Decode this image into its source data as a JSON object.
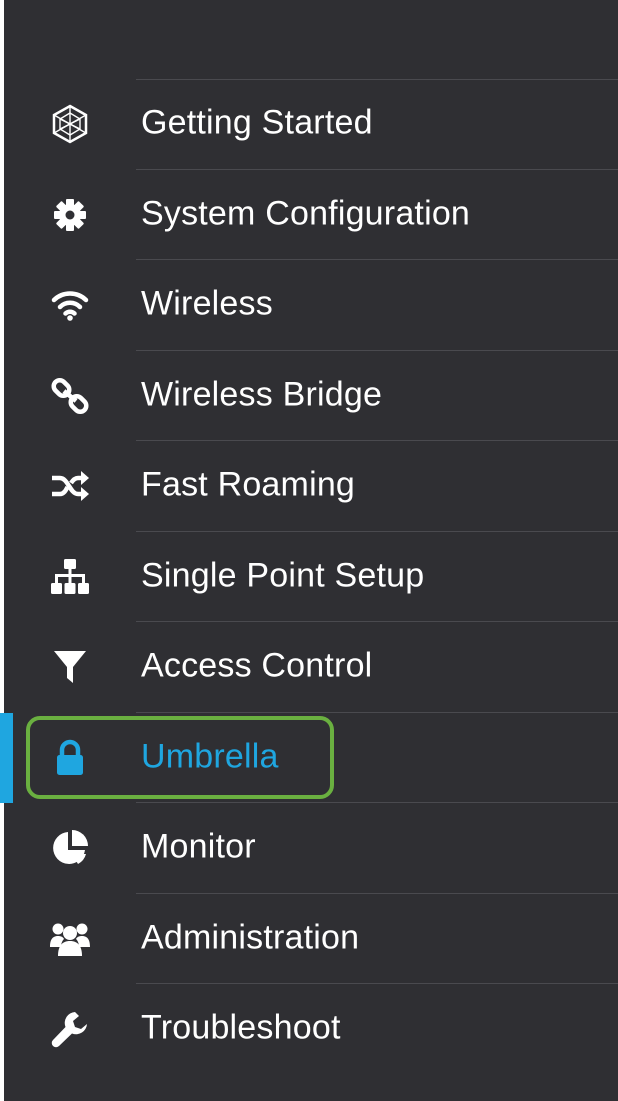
{
  "navigation": {
    "accent_color": "#1fa6e0",
    "highlight_color": "#6ab040",
    "background_color": "#2f2f33",
    "items": [
      {
        "label": "Getting Started",
        "icon": "hexagon-globe-icon",
        "active": false
      },
      {
        "label": "System Configuration",
        "icon": "gear-icon",
        "active": false
      },
      {
        "label": "Wireless",
        "icon": "wifi-icon",
        "active": false
      },
      {
        "label": "Wireless Bridge",
        "icon": "link-icon",
        "active": false
      },
      {
        "label": "Fast Roaming",
        "icon": "shuffle-icon",
        "active": false
      },
      {
        "label": "Single Point Setup",
        "icon": "sitemap-icon",
        "active": false
      },
      {
        "label": "Access Control",
        "icon": "filter-icon",
        "active": false
      },
      {
        "label": "Umbrella",
        "icon": "lock-icon",
        "active": true
      },
      {
        "label": "Monitor",
        "icon": "pie-chart-icon",
        "active": false
      },
      {
        "label": "Administration",
        "icon": "users-icon",
        "active": false
      },
      {
        "label": "Troubleshoot",
        "icon": "wrench-icon",
        "active": false
      }
    ]
  }
}
